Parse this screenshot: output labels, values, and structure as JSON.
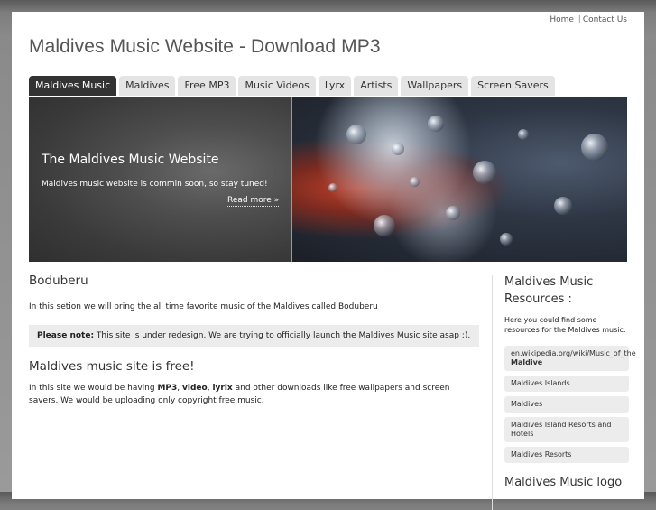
{
  "toplinks": {
    "home": "Home",
    "separator": "|",
    "contact": "Contact Us"
  },
  "site_title": "Maldives Music Website - Download MP3",
  "tabs": [
    {
      "label": "Maldives Music",
      "active": true
    },
    {
      "label": "Maldives",
      "active": false
    },
    {
      "label": "Free MP3",
      "active": false
    },
    {
      "label": "Music Videos",
      "active": false
    },
    {
      "label": "Lyrx",
      "active": false
    },
    {
      "label": "Artists",
      "active": false
    },
    {
      "label": "Wallpapers",
      "active": false
    },
    {
      "label": "Screen Savers",
      "active": false
    }
  ],
  "hero": {
    "heading": "The Maldives Music Website",
    "text": "Maldives music website is commin soon, so stay tuned!",
    "more": "Read more »"
  },
  "main": {
    "section1_title": "Boduberu",
    "section1_text": "In this setion we will bring the all time favorite music of the Maldives called Boduberu",
    "note_label": "Please note:",
    "note_text": " This site is under redesign. We are trying to officially launch the Maldives Music site asap :).",
    "section2_title": "Maldives music site is free!",
    "section2_p1": "In this site we would be having ",
    "section2_mp3": "MP3",
    "section2_comma1": ", ",
    "section2_video": "video",
    "section2_comma2": ", ",
    "section2_lyrix": "lyrix",
    "section2_p2": " and other downloads like free wallpapers and screen savers. We would be uploading only copyright free music."
  },
  "sidebar": {
    "title": "Maldives Music Resources :",
    "intro": "Here you could find some resources for the Maldives music:",
    "items": [
      {
        "line1": "en.wikipedia.org/wiki/Music_of_the_",
        "line2": "Maldive"
      },
      {
        "line1": "Maldives Islands"
      },
      {
        "line1": "Maldives"
      },
      {
        "line1": "Maldives Island Resorts and Hotels"
      },
      {
        "line1": "Maldives Resorts"
      }
    ],
    "title2": "Maldives Music logo"
  },
  "colors": {
    "active_tab": "#333333",
    "tab": "#e4e4e4",
    "note_bg": "#ececec"
  }
}
